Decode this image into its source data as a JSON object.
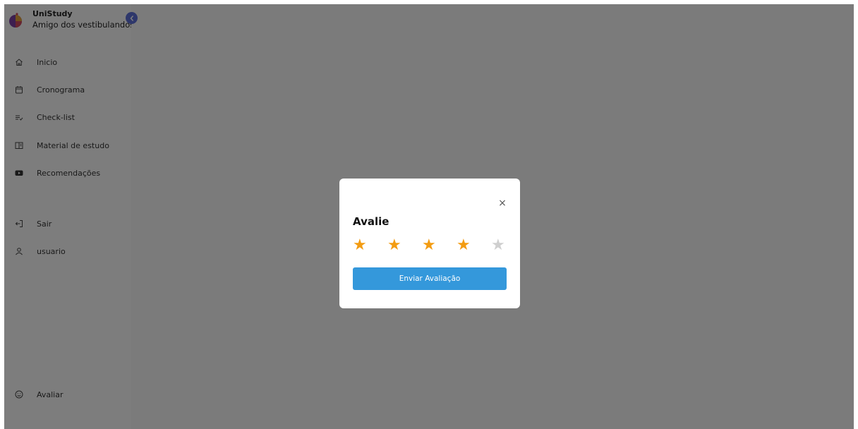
{
  "sidebar": {
    "brand_title": "UniStudy",
    "brand_subtitle": "Amigo dos vestibulandos",
    "items": [
      {
        "label": "Inicio",
        "icon": "home-icon"
      },
      {
        "label": "Cronograma",
        "icon": "calendar-icon"
      },
      {
        "label": "Check-list",
        "icon": "checklist-icon"
      },
      {
        "label": "Material de estudo",
        "icon": "book-icon"
      },
      {
        "label": "Recomendações",
        "icon": "youtube-icon"
      },
      {
        "label": "Sair",
        "icon": "logout-icon"
      },
      {
        "label": "usuario",
        "icon": "user-icon"
      },
      {
        "label": "Avaliar",
        "icon": "smile-icon"
      }
    ]
  },
  "modal": {
    "title": "Avalie",
    "close_label": "×",
    "rating": 4,
    "max_rating": 5,
    "submit_label": "Enviar Avaliação"
  },
  "colors": {
    "accent": "#3498db",
    "star_filled": "#f39c12",
    "star_empty": "#cfcfcf",
    "collapse_button": "#5d6fd6"
  }
}
